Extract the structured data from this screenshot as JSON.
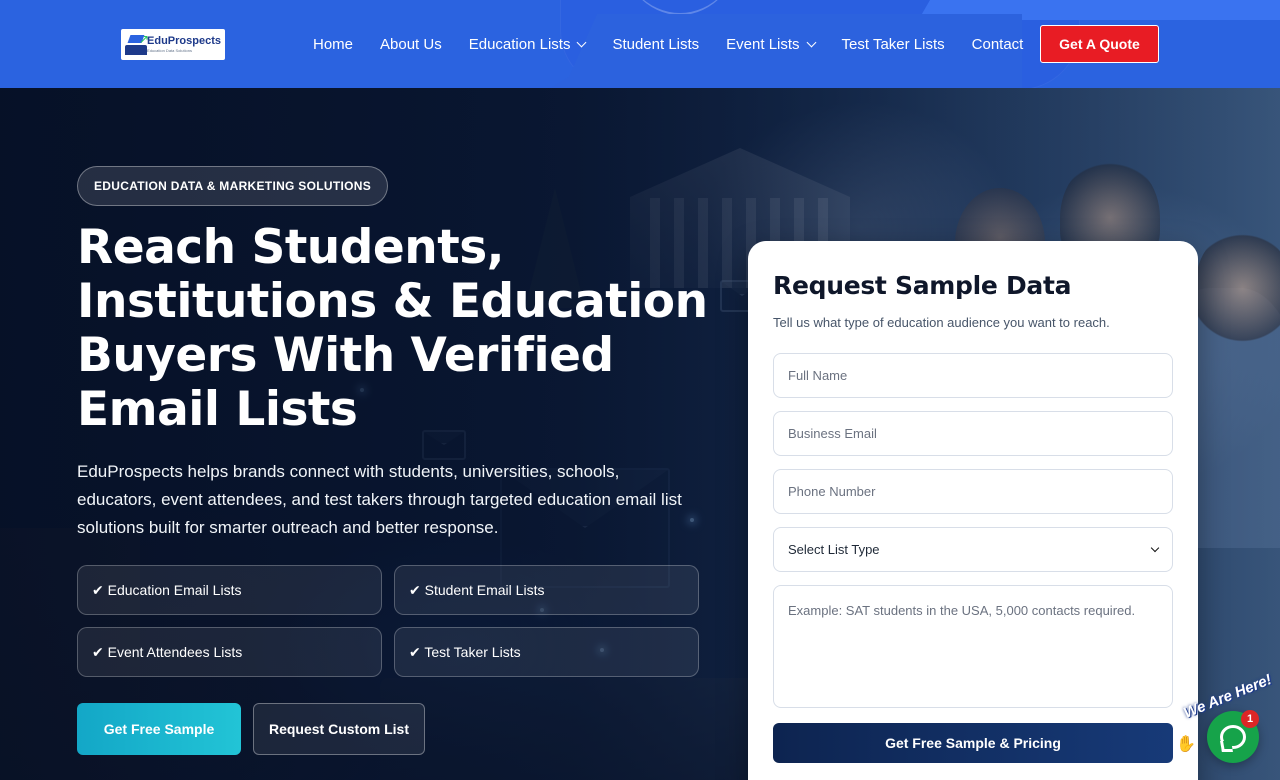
{
  "header": {
    "logo": {
      "brand": "EduProspects",
      "tagline": "Education Data Solutions"
    },
    "nav": [
      {
        "label": "Home",
        "has_dropdown": false
      },
      {
        "label": "About Us",
        "has_dropdown": false
      },
      {
        "label": "Education Lists",
        "has_dropdown": true
      },
      {
        "label": "Student Lists",
        "has_dropdown": false
      },
      {
        "label": "Event Lists",
        "has_dropdown": true
      },
      {
        "label": "Test Taker Lists",
        "has_dropdown": false
      },
      {
        "label": "Contact",
        "has_dropdown": false
      }
    ],
    "cta_label": "Get A Quote"
  },
  "hero": {
    "eyebrow": "EDUCATION DATA & MARKETING SOLUTIONS",
    "headline_lines": [
      "Reach Students,",
      "Institutions & Education",
      "Buyers With Verified",
      "Email Lists"
    ],
    "subtext": "EduProspects helps brands connect with students, universities, schools, educators, event attendees, and test takers through targeted education email list solutions built for smarter outreach and better response.",
    "features": [
      "✔ Education Email Lists",
      "✔ Student Email Lists",
      "✔ Event Attendees Lists",
      "✔ Test Taker Lists"
    ],
    "primary_button": "Get Free Sample",
    "secondary_button": "Request Custom List"
  },
  "form": {
    "title": "Request Sample Data",
    "hint": "Tell us what type of education audience you want to reach.",
    "full_name_placeholder": "Full Name",
    "email_placeholder": "Business Email",
    "phone_placeholder": "Phone Number",
    "list_type_selected": "Select List Type",
    "message_placeholder": "Example: SAT students in the USA, 5,000 contacts required.",
    "submit_label": "Get Free Sample & Pricing"
  },
  "chat": {
    "tagline": "We Are Here!",
    "unread_count": "1"
  },
  "colors": {
    "header_bg": "#2b63e0",
    "quote_button": "#e81c24",
    "primary_button": "#13a7c7",
    "submit_button": "#0d2450",
    "chat_button": "#16a34a"
  }
}
